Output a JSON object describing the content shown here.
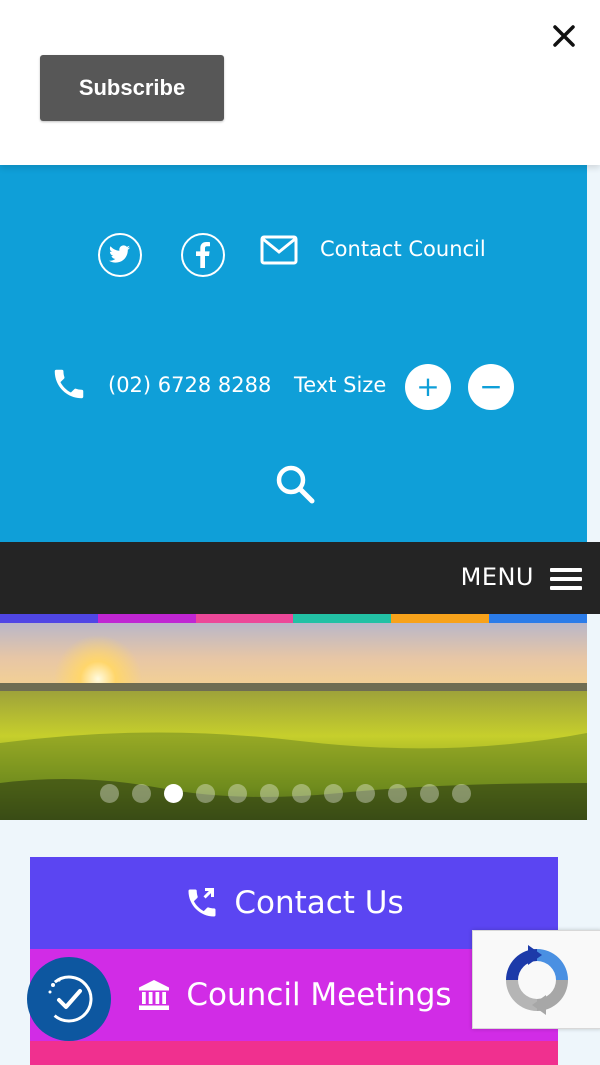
{
  "overlay": {
    "subscribe_label": "Subscribe",
    "close_icon": "close-icon"
  },
  "header": {
    "contact_council_label": "Contact Council",
    "phone": "(02) 6728 8288",
    "text_size_label": "Text Size",
    "increase_symbol": "+",
    "decrease_symbol": "−",
    "icons": [
      "twitter-icon",
      "facebook-icon",
      "mail-icon",
      "phone-icon",
      "search-icon"
    ],
    "background_color": "#0f9fd8"
  },
  "nav": {
    "menu_label": "MENU"
  },
  "color_strip": [
    "#4f46e5",
    "#c026d3",
    "#ec4899",
    "#22c1a5",
    "#f7a21b",
    "#2b7ce9"
  ],
  "slider": {
    "dot_count": 12,
    "active_index": 2
  },
  "quick_links": [
    {
      "label": "Contact Us",
      "icon": "phone-transfer-icon",
      "color": "#5b45f2"
    },
    {
      "label": "Council Meetings",
      "icon": "bank-icon",
      "color": "#d12ce6"
    },
    {
      "label": "",
      "icon": "",
      "color": "#f0308f"
    }
  ],
  "widgets": {
    "accessibility_icon": "accessibility-check-icon",
    "recaptcha_icon": "recaptcha-icon"
  }
}
